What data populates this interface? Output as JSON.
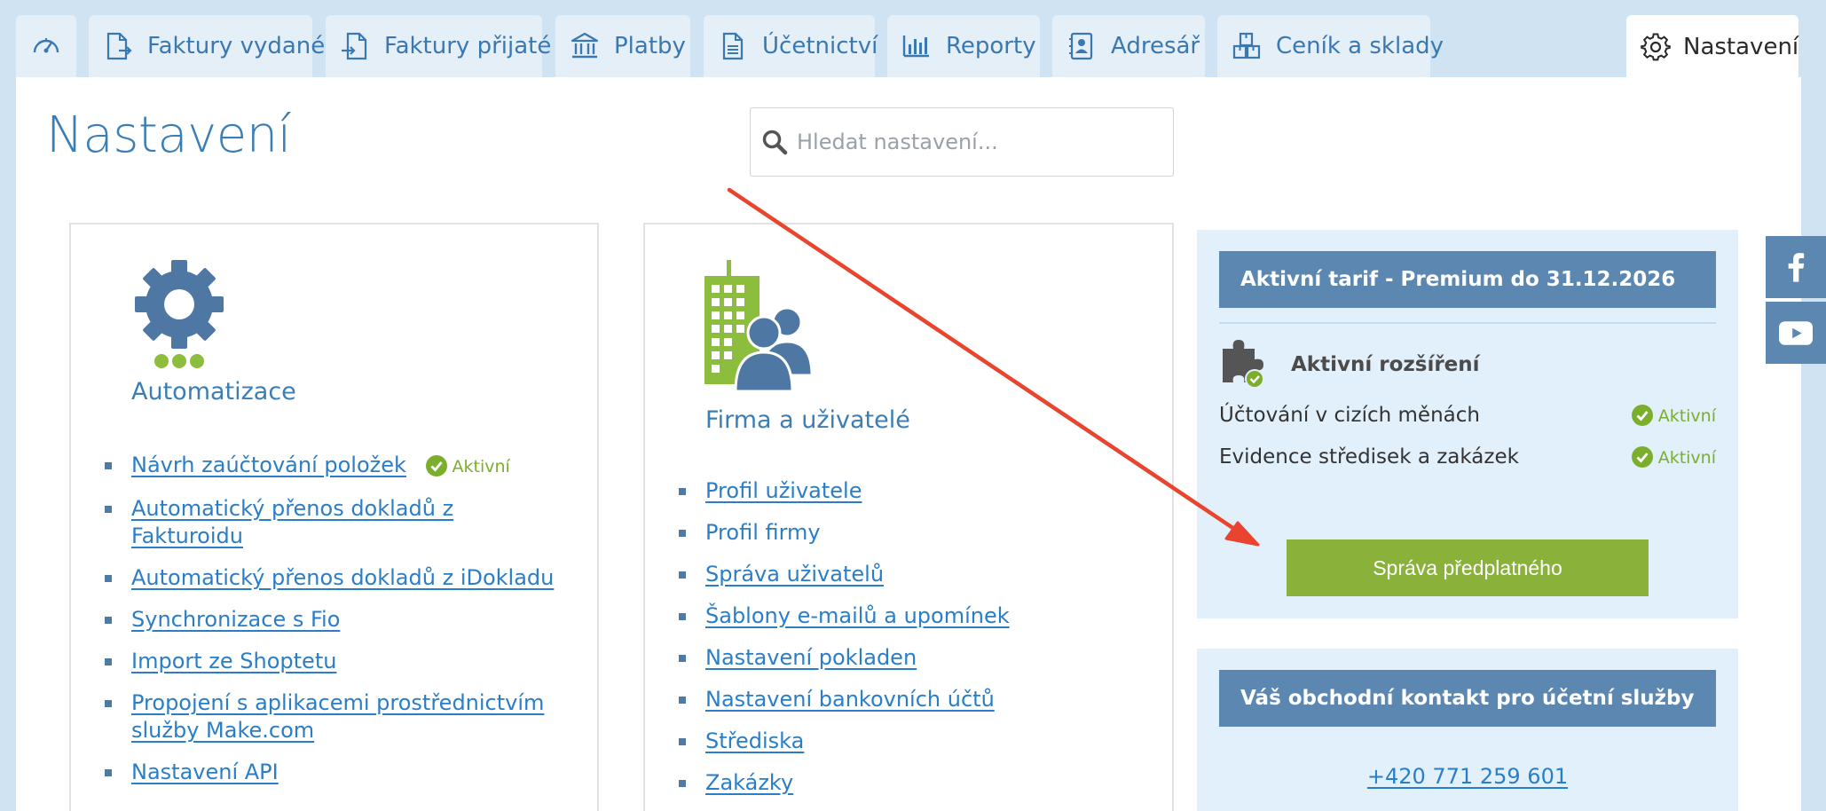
{
  "nav": {
    "tabs": [
      {
        "label": "",
        "icon": "dashboard-gauge-icon"
      },
      {
        "label": "Faktury vydané",
        "icon": "invoice-out-icon"
      },
      {
        "label": "Faktury přijaté",
        "icon": "invoice-in-icon"
      },
      {
        "label": "Platby",
        "icon": "bank-icon"
      },
      {
        "label": "Účetnictví",
        "icon": "document-icon"
      },
      {
        "label": "Reporty",
        "icon": "bar-chart-icon"
      },
      {
        "label": "Adresář",
        "icon": "contact-book-icon"
      },
      {
        "label": "Ceník a sklady",
        "icon": "boxes-icon"
      },
      {
        "label": "Nastavení",
        "icon": "gear-icon"
      }
    ]
  },
  "page": {
    "title": "Nastavení",
    "search_placeholder": "Hledat nastavení..."
  },
  "automation": {
    "title": "Automatizace",
    "items": [
      {
        "label": "Návrh zaúčtování položek",
        "badge": "Aktivní"
      },
      {
        "label": "Automatický přenos dokladů z Fakturoidu"
      },
      {
        "label": "Automatický přenos dokladů z iDokladu"
      },
      {
        "label": "Synchronizace s Fio"
      },
      {
        "label": "Import ze Shoptetu"
      },
      {
        "label": "Propojení s aplikacemi prostřednictvím služby Make.com"
      },
      {
        "label": "Nastavení API"
      }
    ]
  },
  "company": {
    "title": "Firma a uživatelé",
    "items": [
      {
        "label": "Profil uživatele"
      },
      {
        "label": "Profil firmy"
      },
      {
        "label": "Správa uživatelů"
      },
      {
        "label": "Šablony e-mailů a upomínek"
      },
      {
        "label": "Nastavení pokladen"
      },
      {
        "label": "Nastavení bankovních účtů"
      },
      {
        "label": "Střediska"
      },
      {
        "label": "Zakázky"
      }
    ]
  },
  "tariff": {
    "header": "Aktivní tarif - Premium do 31.12.2026",
    "extensions_title": "Aktivní rozšíření",
    "extensions": [
      {
        "name": "Účtování v cizích měnách",
        "status": "Aktivní"
      },
      {
        "name": "Evidence středisek a zakázek",
        "status": "Aktivní"
      }
    ],
    "button": "Správa předplatného"
  },
  "contact": {
    "header": "Váš obchodní kontakt pro účetní služby",
    "phone": "+420 771 259 601"
  },
  "social": [
    "facebook-icon",
    "youtube-icon"
  ],
  "colors": {
    "accent_blue": "#3b7eb5",
    "link_blue": "#2a7ec8",
    "header_blue": "#5b87b1",
    "active_green": "#7cae2e",
    "button_green": "#8ab23a",
    "annotation_red": "#e8442e"
  }
}
